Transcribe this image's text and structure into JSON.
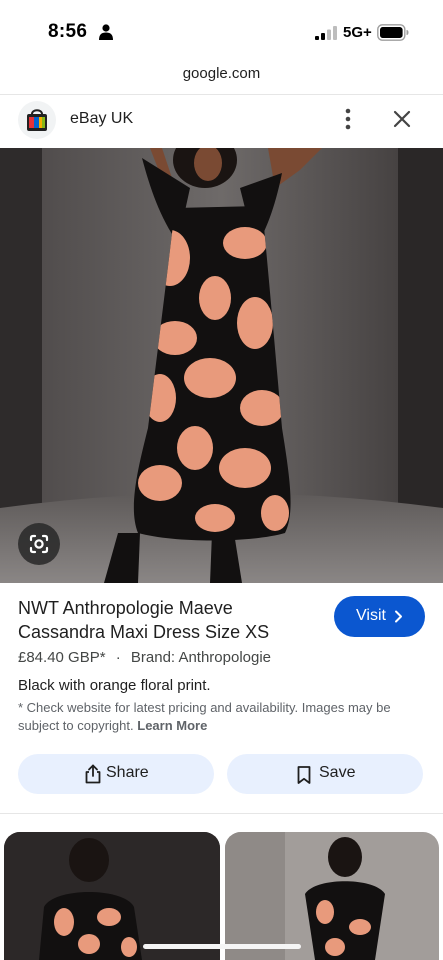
{
  "status_bar": {
    "time": "8:56",
    "network": "5G+"
  },
  "browser": {
    "url": "google.com"
  },
  "site_header": {
    "site_name": "eBay UK",
    "logo_icon": "ebay-bag-icon",
    "menu_icon": "more-vert-icon",
    "close_icon": "close-icon"
  },
  "hero": {
    "lens_icon": "google-lens-icon"
  },
  "product": {
    "title": "NWT Anthropologie Maeve Cassandra Maxi Dress Size XS",
    "visit_label": "Visit",
    "price": "£84.40 GBP*",
    "separator": "·",
    "brand": "Brand: Anthropologie",
    "description": "Black with orange floral print.",
    "disclaimer": "* Check website for latest pricing and availability. Images may be subject to copyright.",
    "learn_more": "Learn More"
  },
  "actions": {
    "share_label": "Share",
    "save_label": "Save"
  },
  "colors": {
    "accent": "#0b57d0",
    "button_bg": "#e8f0fe",
    "dress_black": "#121010",
    "flower_orange": "#e89a7c"
  }
}
